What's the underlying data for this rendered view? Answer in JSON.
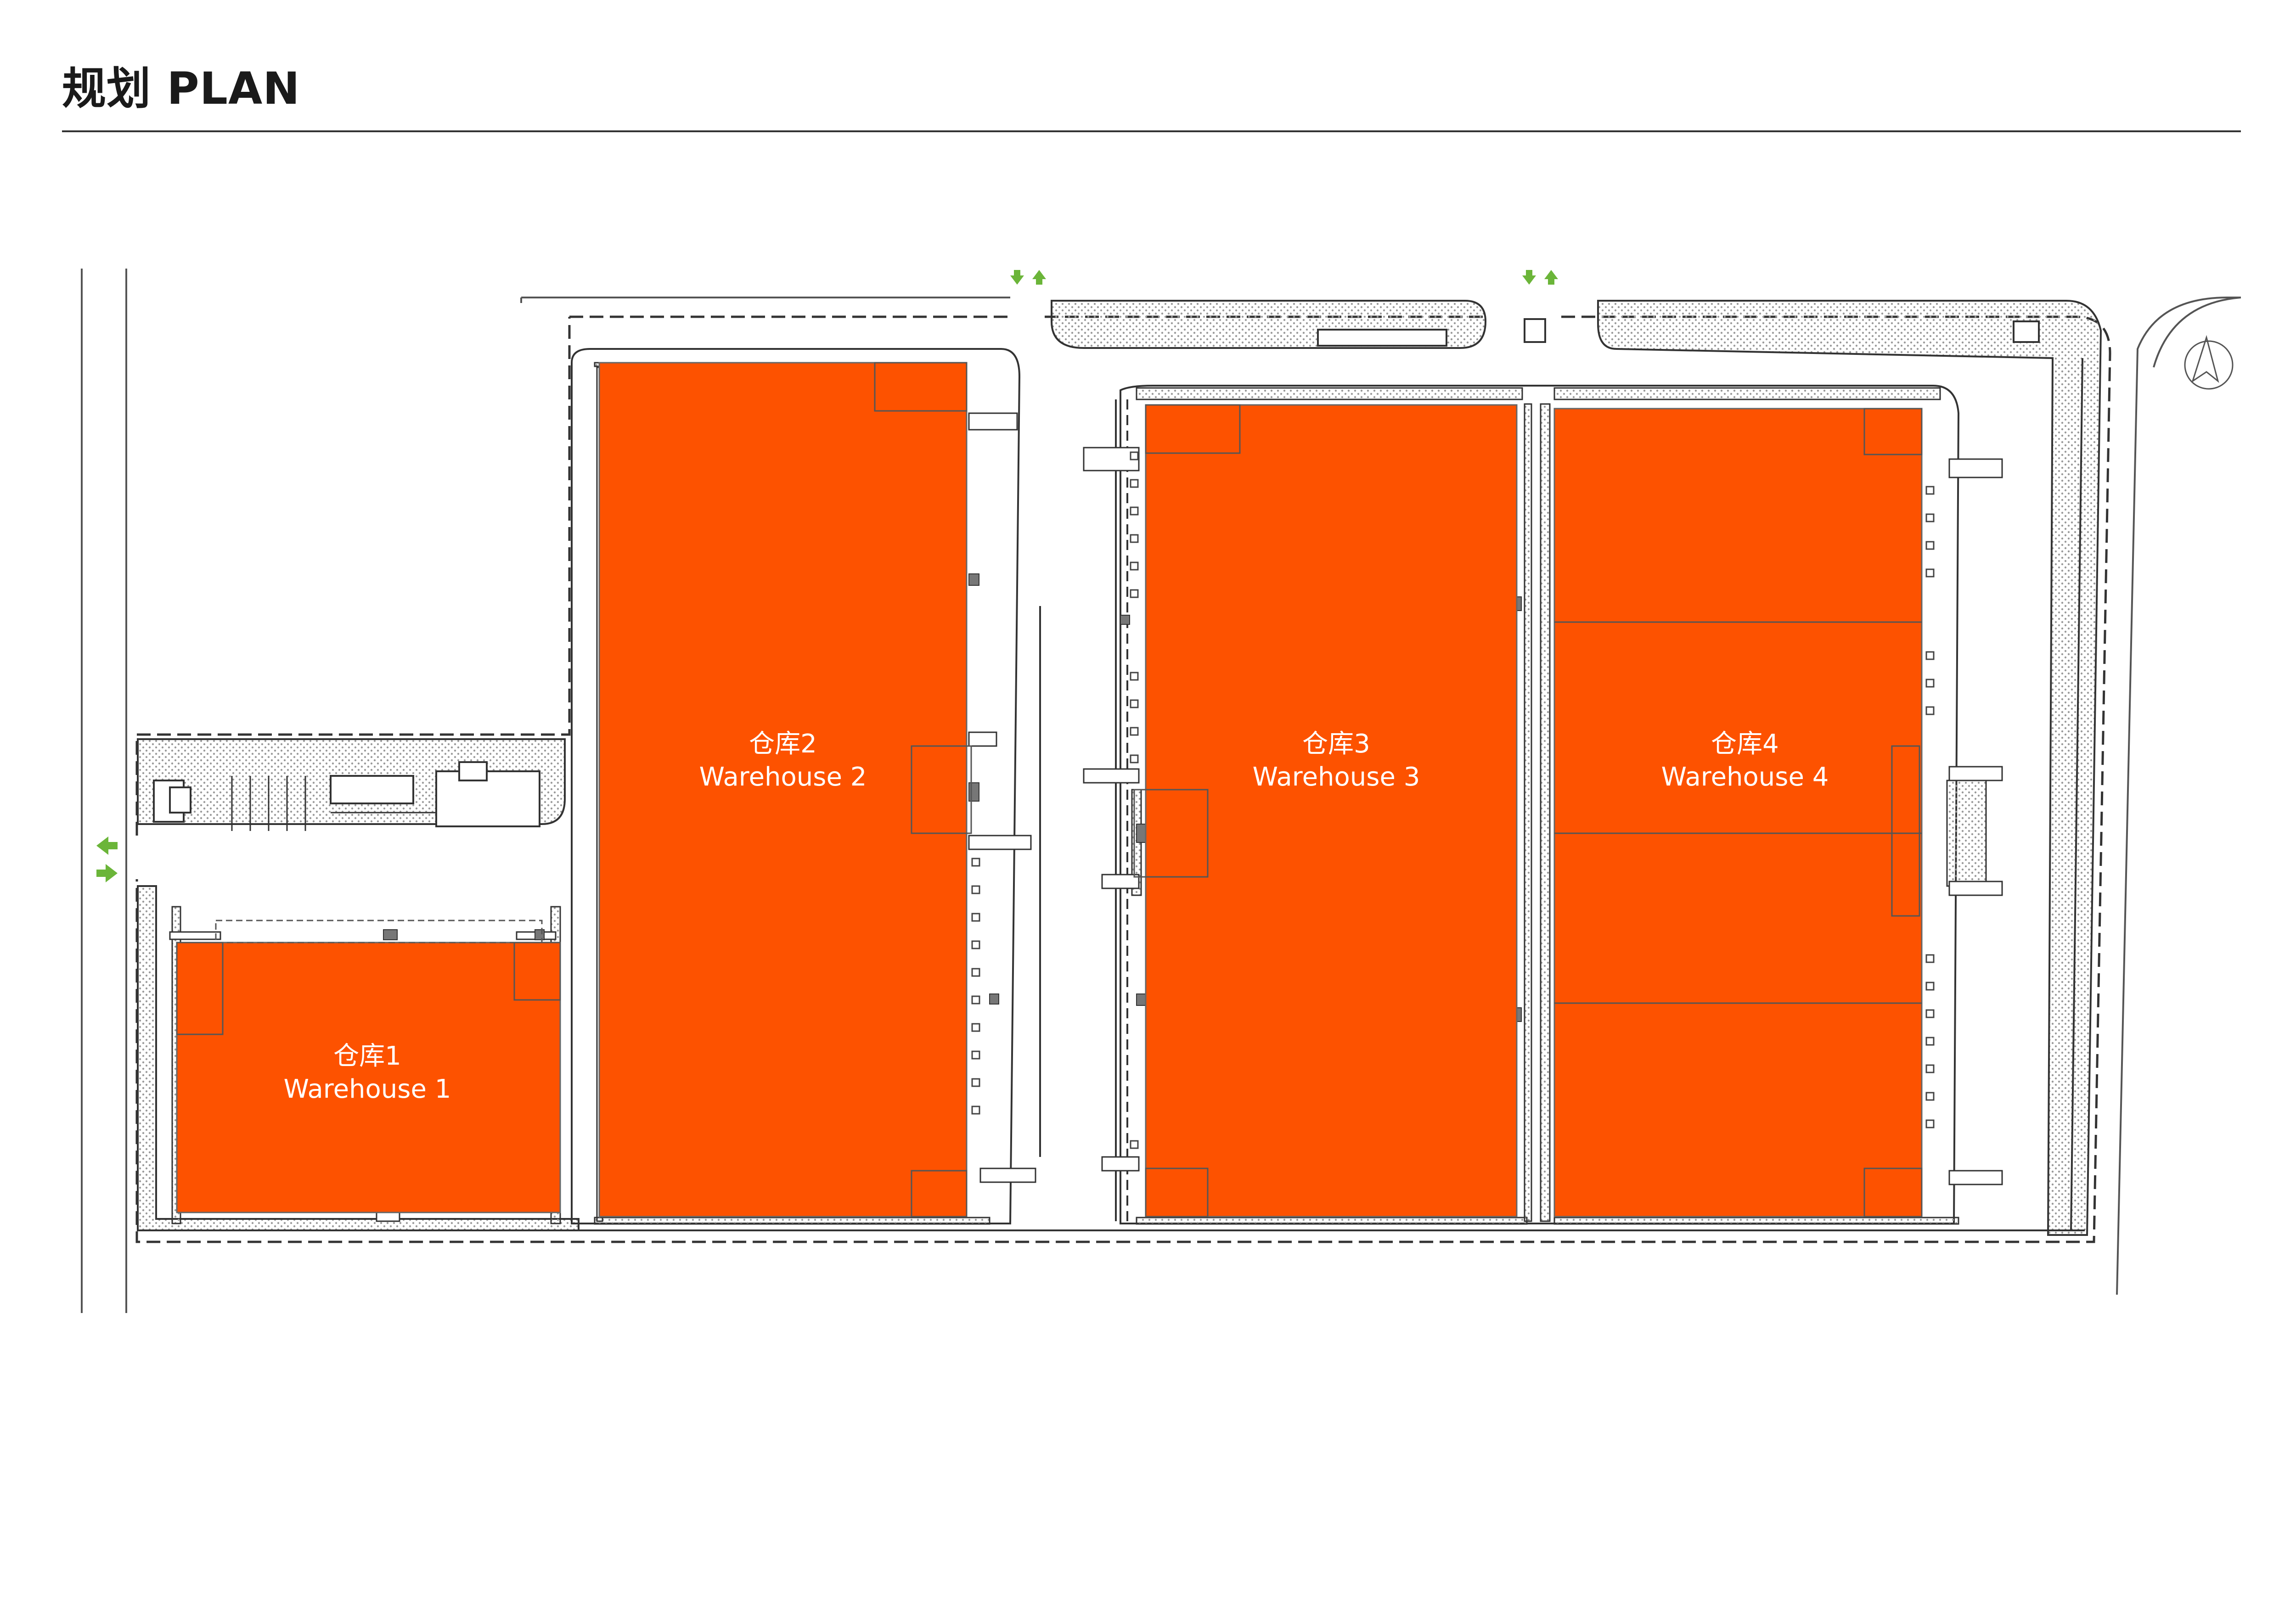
{
  "header": {
    "title": "规划 PLAN"
  },
  "colors": {
    "warehouse_fill": "#FD5200",
    "arrow": "#6BB539",
    "linework": "#444444",
    "paving_dots": "#9a9a9a"
  },
  "warehouses": [
    {
      "id": "w1",
      "label_cn": "仓库1",
      "label_en": "Warehouse 1"
    },
    {
      "id": "w2",
      "label_cn": "仓库2",
      "label_en": "Warehouse 2"
    },
    {
      "id": "w3",
      "label_cn": "仓库3",
      "label_en": "Warehouse 3"
    },
    {
      "id": "w4",
      "label_cn": "仓库4",
      "label_en": "Warehouse 4"
    }
  ],
  "icons": {
    "north": "north-arrow-icon",
    "access": "entry-exit-arrows-icon"
  }
}
